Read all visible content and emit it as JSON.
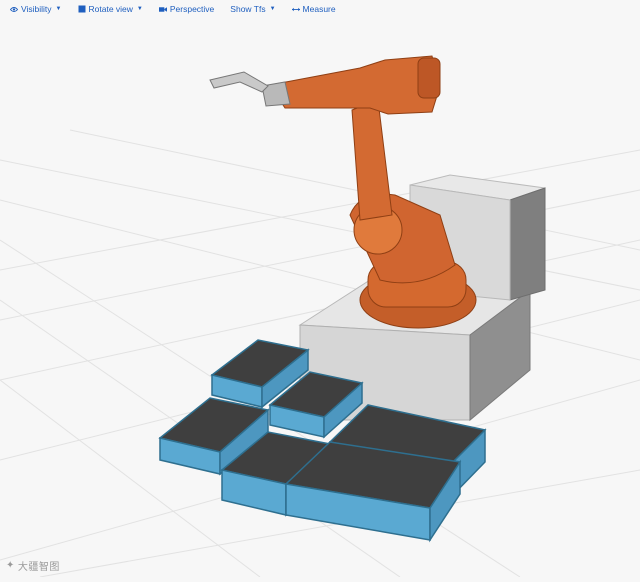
{
  "toolbar": {
    "visibility": "Visibility",
    "rotate_view": "Rotate view",
    "perspective": "Perspective",
    "show_tfs": "Show Tfs",
    "measure": "Measure"
  },
  "watermark": {
    "text": "大疆智图"
  },
  "colors": {
    "link": "#1f5fbf",
    "robot": "#d4692f",
    "bins": "#5aa9d2",
    "pedestal": "#d8d8d8"
  },
  "icons": [
    "eye-icon",
    "cube-icon",
    "video-camera-icon",
    "ruler-icon"
  ]
}
